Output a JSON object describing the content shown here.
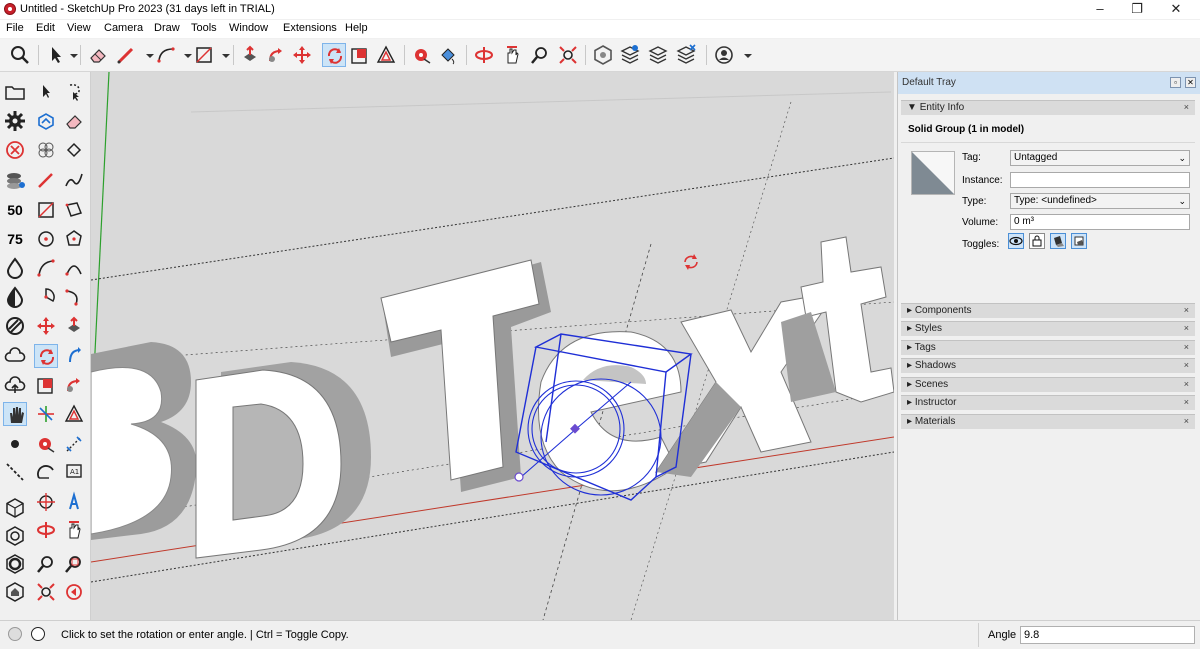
{
  "window": {
    "title": "Untitled - SketchUp Pro 2023 (31 days left in TRIAL)"
  },
  "menu": [
    {
      "label": "File",
      "accel": "F",
      "rest": "ile"
    },
    {
      "label": "Edit",
      "accel": "E",
      "rest": "dit"
    },
    {
      "label": "View",
      "accel": "V",
      "rest": "iew"
    },
    {
      "label": "Camera",
      "accel": "C",
      "rest": "amera"
    },
    {
      "label": "Draw",
      "accel": "D",
      "rest": "raw",
      "pre": ""
    },
    {
      "label": "Tools",
      "accel": "T",
      "rest": "ools"
    },
    {
      "label": "Window",
      "accel": "W",
      "rest": "indow"
    },
    {
      "label": "Extensions",
      "accel": "x",
      "pre": "E",
      "rest": "tensions"
    },
    {
      "label": "Help",
      "accel": "H",
      "rest": "elp"
    }
  ],
  "left_toolbar": {
    "section_labels": [
      "50",
      "75"
    ]
  },
  "viewport": {
    "model_text": "3D Text"
  },
  "tray": {
    "title": "Default Tray",
    "entity_info": {
      "panel_label": "Entity Info",
      "heading": "Solid Group (1 in model)",
      "tag_label": "Tag:",
      "tag_value": "Untagged",
      "instance_label": "Instance:",
      "instance_value": "",
      "type_label": "Type:",
      "type_value": "Type: <undefined>",
      "volume_label": "Volume:",
      "volume_value": "0 m³",
      "toggles_label": "Toggles:"
    },
    "panels": [
      "Components",
      "Styles",
      "Tags",
      "Shadows",
      "Scenes",
      "Instructor",
      "Materials"
    ]
  },
  "status": {
    "message": "Click to set the rotation or enter angle. | Ctrl = Toggle Copy.",
    "angle_label": "Angle",
    "angle_value": "9.8"
  },
  "colors": {
    "accent": "#cce4f7",
    "axis_red": "#c0392b",
    "axis_green": "#2ca02c",
    "selection_blue": "#1f2fd6"
  }
}
